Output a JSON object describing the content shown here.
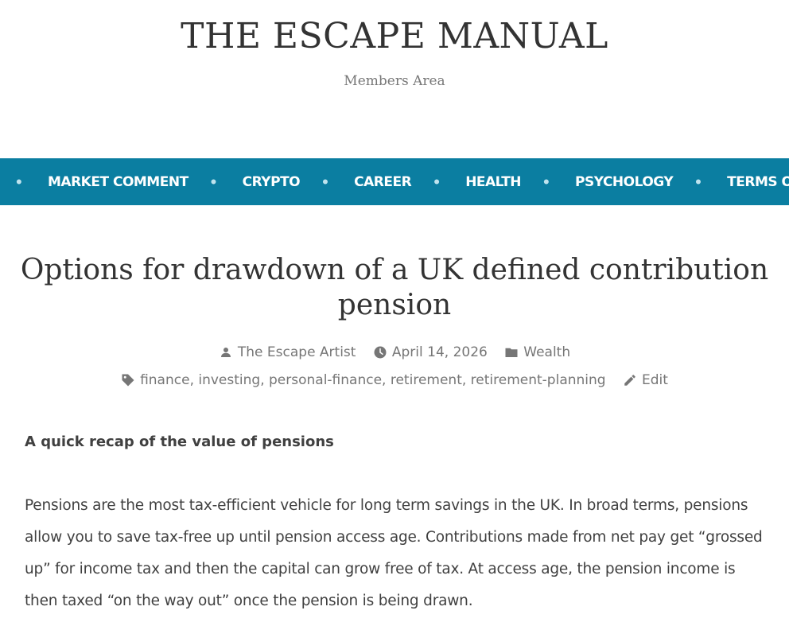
{
  "site": {
    "title": "THE ESCAPE MANUAL",
    "description": "Members Area"
  },
  "nav": {
    "items": [
      {
        "label": "MARKET COMMENT"
      },
      {
        "label": "CRYPTO"
      },
      {
        "label": "CAREER"
      },
      {
        "label": "HEALTH"
      },
      {
        "label": "PSYCHOLOGY"
      },
      {
        "label": "TERMS OF USE"
      }
    ],
    "bullet": "•"
  },
  "post": {
    "title": "Options for drawdown of a UK defined contribution pension",
    "author": "The Escape Artist",
    "date": "April 14, 2026",
    "category": "Wealth",
    "tags": [
      "finance",
      "investing",
      "personal-finance",
      "retirement",
      "retirement-planning"
    ],
    "tag_separator": ",",
    "edit_label": "Edit"
  },
  "content": {
    "heading": "A quick recap of the value of pensions",
    "paragraph": "Pensions are the most tax-efficient vehicle for long term savings in the UK. In broad terms, pensions allow you to save tax-free up until pension access age. Contributions made from net pay get “grossed up” for income tax and then the capital can grow free of tax. At access age, the pension income is then taxed “on the way out” once the pension is being drawn."
  },
  "colors": {
    "nav_background": "#0b7ea1",
    "nav_text": "#ffffff",
    "meta_text": "#767676",
    "body_text": "#404040"
  },
  "icons": {
    "author": "person-icon",
    "date": "clock-icon",
    "category": "folder-icon",
    "tags": "tag-icon",
    "edit": "pencil-icon"
  }
}
